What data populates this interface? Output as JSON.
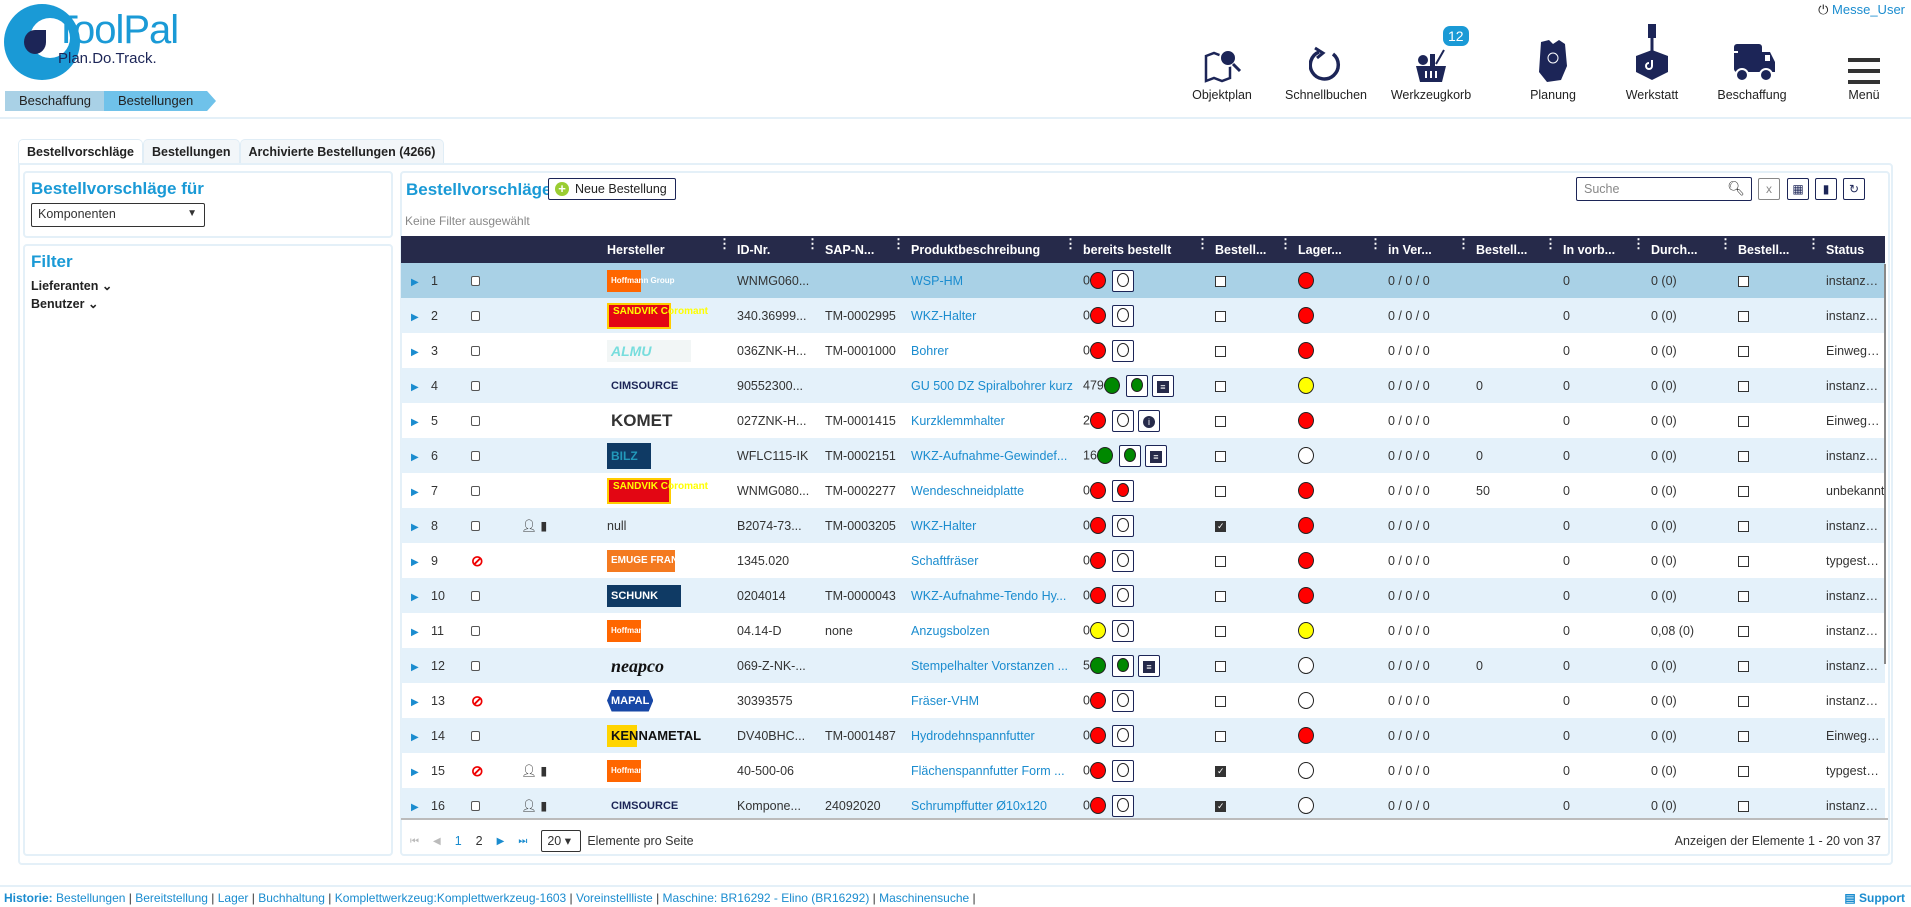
{
  "header": {
    "logo_text": "ToolPal",
    "logo_tagline": "Plan.Do.Track.",
    "user": "Messe_User",
    "breadcrumb": [
      "Beschaffung",
      "Bestellungen"
    ],
    "nav": [
      {
        "label": "Objektplan",
        "icon": "map-search-icon"
      },
      {
        "label": "Schnellbuchen",
        "icon": "refresh-icon"
      },
      {
        "label": "Werkzeugkorb",
        "icon": "basket-icon",
        "badge": "12"
      },
      {
        "label": "Planung",
        "icon": "planning-icon"
      },
      {
        "label": "Werkstatt",
        "icon": "workshop-icon"
      },
      {
        "label": "Beschaffung",
        "icon": "truck-icon"
      },
      {
        "label": "Menü",
        "icon": "hamburger-icon"
      }
    ]
  },
  "tabs": [
    "Bestellvorschläge",
    "Bestellungen",
    "Archivierte Bestellungen (4266)"
  ],
  "left": {
    "title": "Bestellvorschläge für",
    "select_value": "Komponenten",
    "filter_title": "Filter",
    "filters": [
      "Lieferanten",
      "Benutzer"
    ]
  },
  "main": {
    "title": "Bestellvorschläge",
    "new_button": "Neue Bestellung",
    "no_filter": "Keine Filter ausgewählt",
    "search_placeholder": "Suche",
    "columns": [
      "",
      "",
      "",
      "",
      "Hersteller",
      "ID-Nr.",
      "SAP-N...",
      "Produktbeschreibung",
      "bereits bestellt",
      "Bestell...",
      "Lager...",
      "in Ver...",
      "Bestell...",
      "In vorb...",
      "Durch...",
      "Bestell...",
      "Status"
    ],
    "colors": {
      "red": "#ff0000",
      "green": "#008000",
      "yellow": "#ffff00",
      "header": "#262a4a",
      "accent": "#1a9ad6"
    },
    "rows": [
      {
        "n": "1",
        "blocked": false,
        "actions": false,
        "mfr": "Hoffmann Group",
        "logo": "hoffmann",
        "id": "WNMG060...",
        "sap": "",
        "desc": "WSP-HM",
        "ord": "0",
        "ordc": "red",
        "btn": "white",
        "extra": "",
        "chk": false,
        "lager": "red",
        "inver": "0 / 0 / 0",
        "best": "",
        "vorb": "0",
        "durch": "0 (0)",
        "status": "instanzges..."
      },
      {
        "n": "2",
        "blocked": false,
        "actions": false,
        "mfr": "SANDVIK Coromant",
        "logo": "sandvik",
        "id": "340.36999...",
        "sap": "TM-0002995",
        "desc": "WKZ-Halter",
        "ord": "0",
        "ordc": "red",
        "btn": "white",
        "extra": "",
        "chk": false,
        "lager": "red",
        "inver": "0 / 0 / 0",
        "best": "",
        "vorb": "0",
        "durch": "0 (0)",
        "status": "instanzges..."
      },
      {
        "n": "3",
        "blocked": false,
        "actions": false,
        "mfr": "ALMU",
        "logo": "almu",
        "id": "036ZNK-H...",
        "sap": "TM-0001000",
        "desc": "Bohrer",
        "ord": "0",
        "ordc": "red",
        "btn": "white",
        "extra": "",
        "chk": false,
        "lager": "red",
        "inver": "0 / 0 / 0",
        "best": "",
        "vorb": "0",
        "durch": "0 (0)",
        "status": "Einwegwe..."
      },
      {
        "n": "4",
        "blocked": false,
        "actions": false,
        "mfr": "CIMSOURCE",
        "logo": "cim",
        "id": "90552300...",
        "sap": "",
        "desc": "GU 500 DZ Spiralbohrer kurz",
        "ord": "479",
        "ordc": "green",
        "btn": "green",
        "extra": "doc",
        "chk": false,
        "lager": "yellow",
        "inver": "0 / 0 / 0",
        "best": "0",
        "vorb": "0",
        "durch": "0 (0)",
        "status": "instanzges..."
      },
      {
        "n": "5",
        "blocked": false,
        "actions": false,
        "mfr": "KOMET",
        "logo": "komet",
        "id": "027ZNK-H...",
        "sap": "TM-0001415",
        "desc": "Kurzklemmhalter",
        "ord": "2",
        "ordc": "red",
        "btn": "white",
        "extra": "info",
        "chk": false,
        "lager": "red",
        "inver": "0 / 0 / 0",
        "best": "",
        "vorb": "0",
        "durch": "0 (0)",
        "status": "Einwegwe..."
      },
      {
        "n": "6",
        "blocked": false,
        "actions": false,
        "mfr": "BILZ",
        "logo": "bilz",
        "id": "WFLC115-IK",
        "sap": "TM-0002151",
        "desc": "WKZ-Aufnahme-Gewindef...",
        "ord": "16",
        "ordc": "green",
        "btn": "green",
        "extra": "doc",
        "chk": false,
        "lager": "white",
        "inver": "0 / 0 / 0",
        "best": "0",
        "vorb": "0",
        "durch": "0 (0)",
        "status": "instanzges..."
      },
      {
        "n": "7",
        "blocked": false,
        "actions": false,
        "mfr": "SANDVIK Coromant",
        "logo": "sandvik",
        "id": "WNMG080...",
        "sap": "TM-0002277",
        "desc": "Wendeschneidplatte",
        "ord": "0",
        "ordc": "red",
        "btn": "red",
        "extra": "",
        "chk": false,
        "lager": "red",
        "inver": "0 / 0 / 0",
        "best": "50",
        "vorb": "0",
        "durch": "0 (0)",
        "status": "unbekannt"
      },
      {
        "n": "8",
        "blocked": false,
        "actions": true,
        "mfr": "null",
        "logo": "null",
        "id": "B2074-73...",
        "sap": "TM-0003205",
        "desc": "WKZ-Halter",
        "ord": "0",
        "ordc": "red",
        "btn": "white",
        "extra": "",
        "chk": true,
        "lager": "red",
        "inver": "0 / 0 / 0",
        "best": "",
        "vorb": "0",
        "durch": "0 (0)",
        "status": "instanzges..."
      },
      {
        "n": "9",
        "blocked": true,
        "actions": false,
        "mfr": "EMUGE FRANKEN",
        "logo": "emuge",
        "id": "1345.020",
        "sap": "",
        "desc": "Schaftfräser",
        "ord": "0",
        "ordc": "red",
        "btn": "white",
        "extra": "",
        "chk": false,
        "lager": "red",
        "inver": "0 / 0 / 0",
        "best": "",
        "vorb": "0",
        "durch": "0 (0)",
        "status": "typgesteuer..."
      },
      {
        "n": "10",
        "blocked": false,
        "actions": false,
        "mfr": "SCHUNK",
        "logo": "schunk",
        "id": "0204014",
        "sap": "TM-0000043",
        "desc": "WKZ-Aufnahme-Tendo Hy...",
        "ord": "0",
        "ordc": "red",
        "btn": "white",
        "extra": "",
        "chk": false,
        "lager": "red",
        "inver": "0 / 0 / 0",
        "best": "",
        "vorb": "0",
        "durch": "0 (0)",
        "status": "instanzges..."
      },
      {
        "n": "11",
        "blocked": false,
        "actions": false,
        "mfr": "Hoffmann Group",
        "logo": "hoffmann",
        "id": "04.14-D",
        "sap": "none",
        "desc": "Anzugsbolzen",
        "ord": "0",
        "ordc": "yellow",
        "btn": "white",
        "extra": "",
        "chk": false,
        "lager": "yellow",
        "inver": "0 / 0 / 0",
        "best": "",
        "vorb": "0",
        "durch": "0,08 (0)",
        "status": "instanzges..."
      },
      {
        "n": "12",
        "blocked": false,
        "actions": false,
        "mfr": "neapco",
        "logo": "neapco",
        "id": "069-Z-NK-...",
        "sap": "",
        "desc": "Stempelhalter Vorstanzen ...",
        "ord": "5",
        "ordc": "green",
        "btn": "green",
        "extra": "doc",
        "chk": false,
        "lager": "white",
        "inver": "0 / 0 / 0",
        "best": "0",
        "vorb": "0",
        "durch": "0 (0)",
        "status": "instanzges..."
      },
      {
        "n": "13",
        "blocked": true,
        "actions": false,
        "mfr": "MAPAL",
        "logo": "mapal",
        "id": "30393575",
        "sap": "",
        "desc": "Fräser-VHM",
        "ord": "0",
        "ordc": "red",
        "btn": "white",
        "extra": "",
        "chk": false,
        "lager": "white",
        "inver": "0 / 0 / 0",
        "best": "",
        "vorb": "0",
        "durch": "0 (0)",
        "status": "instanzges..."
      },
      {
        "n": "14",
        "blocked": false,
        "actions": false,
        "mfr": "KENNAMETAL",
        "logo": "ken",
        "id": "DV40BHC...",
        "sap": "TM-0001487",
        "desc": "Hydrodehnspannfutter",
        "ord": "0",
        "ordc": "red",
        "btn": "white",
        "extra": "",
        "chk": false,
        "lager": "red",
        "inver": "0 / 0 / 0",
        "best": "",
        "vorb": "0",
        "durch": "0 (0)",
        "status": "Einwegwe..."
      },
      {
        "n": "15",
        "blocked": true,
        "actions": true,
        "mfr": "Hoffmann Group",
        "logo": "hoffmann",
        "id": "40-500-06",
        "sap": "",
        "desc": "Flächenspannfutter Form ...",
        "ord": "0",
        "ordc": "red",
        "btn": "white",
        "extra": "",
        "chk": true,
        "lager": "white",
        "inver": "0 / 0 / 0",
        "best": "",
        "vorb": "0",
        "durch": "0 (0)",
        "status": "typgesteuer..."
      },
      {
        "n": "16",
        "blocked": false,
        "actions": true,
        "mfr": "CIMSOURCE",
        "logo": "cim",
        "id": "Kompone...",
        "sap": "24092020",
        "desc": "Schrumpffutter Ø10x120",
        "ord": "0",
        "ordc": "red",
        "btn": "white",
        "extra": "",
        "chk": true,
        "lager": "white",
        "inver": "0 / 0 / 0",
        "best": "",
        "vorb": "0",
        "durch": "0 (0)",
        "status": "instanzges..."
      }
    ]
  },
  "pager": {
    "pages": [
      "1",
      "2"
    ],
    "page_size": "20",
    "page_size_label": "Elemente pro Seite",
    "count": "Anzeigen der Elemente 1 - 20 von 37"
  },
  "footer": {
    "label": "Historie:",
    "links": [
      "Bestellungen",
      "Bereitstellung",
      "Lager",
      "Buchhaltung",
      "Komplettwerkzeug:Komplettwerkzeug-1603",
      "Voreinstellliste",
      "Maschine: BR16292 - Elino (BR16292)",
      "Maschinensuche"
    ],
    "support": "Support"
  }
}
